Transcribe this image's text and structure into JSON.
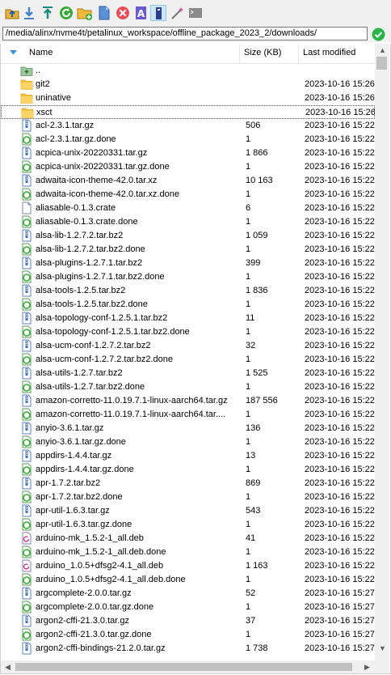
{
  "toolbar": {
    "buttons": [
      {
        "name": "parent-dir-button",
        "icon": "folder-up-icon"
      },
      {
        "name": "download-button",
        "icon": "download-arrow-icon"
      },
      {
        "name": "upload-button",
        "icon": "upload-arrow-icon"
      },
      {
        "name": "refresh-button",
        "icon": "refresh-icon"
      },
      {
        "name": "new-folder-button",
        "icon": "new-folder-icon"
      },
      {
        "name": "new-file-button",
        "icon": "new-file-icon"
      },
      {
        "name": "delete-button",
        "icon": "delete-icon"
      },
      {
        "name": "rename-button",
        "icon": "rename-icon"
      },
      {
        "name": "properties-button",
        "icon": "properties-icon"
      },
      {
        "name": "filter-button",
        "icon": "magic-wand-icon"
      },
      {
        "name": "terminal-button",
        "icon": "terminal-icon"
      }
    ]
  },
  "path": {
    "value": "/media/alinx/nvme4t/petalinux_workspace/offline_package_2023_2/downloads/"
  },
  "columns": {
    "name": "Name",
    "size": "Size (KB)",
    "modified": "Last modified"
  },
  "colors": {
    "folder": "#f5c342",
    "selection_border": "#555555",
    "ok_green": "#2db34a"
  },
  "files": [
    {
      "name": "..",
      "size": "",
      "date": "",
      "icon": "parent-folder-icon"
    },
    {
      "name": "git2",
      "size": "",
      "date": "2023-10-16 15:26",
      "icon": "folder-icon"
    },
    {
      "name": "uninative",
      "size": "",
      "date": "2023-10-16 15:26",
      "icon": "folder-icon"
    },
    {
      "name": "xsct",
      "size": "",
      "date": "2023-10-16 15:26",
      "icon": "folder-icon",
      "focused": true
    },
    {
      "name": "acl-2.3.1.tar.gz",
      "size": "506",
      "date": "2023-10-16 15:22",
      "icon": "archive-icon"
    },
    {
      "name": "acl-2.3.1.tar.gz.done",
      "size": "1",
      "date": "2023-10-16 15:22",
      "icon": "done-file-icon"
    },
    {
      "name": "acpica-unix-20220331.tar.gz",
      "size": "1 866",
      "date": "2023-10-16 15:22",
      "icon": "archive-icon"
    },
    {
      "name": "acpica-unix-20220331.tar.gz.done",
      "size": "1",
      "date": "2023-10-16 15:22",
      "icon": "done-file-icon"
    },
    {
      "name": "adwaita-icon-theme-42.0.tar.xz",
      "size": "10 163",
      "date": "2023-10-16 15:22",
      "icon": "archive-icon"
    },
    {
      "name": "adwaita-icon-theme-42.0.tar.xz.done",
      "size": "1",
      "date": "2023-10-16 15:22",
      "icon": "done-file-icon"
    },
    {
      "name": "aliasable-0.1.3.crate",
      "size": "6",
      "date": "2023-10-16 15:22",
      "icon": "file-icon"
    },
    {
      "name": "aliasable-0.1.3.crate.done",
      "size": "1",
      "date": "2023-10-16 15:22",
      "icon": "done-file-icon"
    },
    {
      "name": "alsa-lib-1.2.7.2.tar.bz2",
      "size": "1 059",
      "date": "2023-10-16 15:22",
      "icon": "archive-icon"
    },
    {
      "name": "alsa-lib-1.2.7.2.tar.bz2.done",
      "size": "1",
      "date": "2023-10-16 15:22",
      "icon": "done-file-icon"
    },
    {
      "name": "alsa-plugins-1.2.7.1.tar.bz2",
      "size": "399",
      "date": "2023-10-16 15:22",
      "icon": "archive-icon"
    },
    {
      "name": "alsa-plugins-1.2.7.1.tar.bz2.done",
      "size": "1",
      "date": "2023-10-16 15:22",
      "icon": "done-file-icon"
    },
    {
      "name": "alsa-tools-1.2.5.tar.bz2",
      "size": "1 836",
      "date": "2023-10-16 15:22",
      "icon": "archive-icon"
    },
    {
      "name": "alsa-tools-1.2.5.tar.bz2.done",
      "size": "1",
      "date": "2023-10-16 15:22",
      "icon": "done-file-icon"
    },
    {
      "name": "alsa-topology-conf-1.2.5.1.tar.bz2",
      "size": "11",
      "date": "2023-10-16 15:22",
      "icon": "archive-icon"
    },
    {
      "name": "alsa-topology-conf-1.2.5.1.tar.bz2.done",
      "size": "1",
      "date": "2023-10-16 15:22",
      "icon": "done-file-icon"
    },
    {
      "name": "alsa-ucm-conf-1.2.7.2.tar.bz2",
      "size": "32",
      "date": "2023-10-16 15:22",
      "icon": "archive-icon"
    },
    {
      "name": "alsa-ucm-conf-1.2.7.2.tar.bz2.done",
      "size": "1",
      "date": "2023-10-16 15:22",
      "icon": "done-file-icon"
    },
    {
      "name": "alsa-utils-1.2.7.tar.bz2",
      "size": "1 525",
      "date": "2023-10-16 15:22",
      "icon": "archive-icon"
    },
    {
      "name": "alsa-utils-1.2.7.tar.bz2.done",
      "size": "1",
      "date": "2023-10-16 15:22",
      "icon": "done-file-icon"
    },
    {
      "name": "amazon-corretto-11.0.19.7.1-linux-aarch64.tar.gz",
      "size": "187 556",
      "date": "2023-10-16 15:22",
      "icon": "archive-icon"
    },
    {
      "name": "amazon-corretto-11.0.19.7.1-linux-aarch64.tar....",
      "size": "1",
      "date": "2023-10-16 15:22",
      "icon": "done-file-icon"
    },
    {
      "name": "anyio-3.6.1.tar.gz",
      "size": "136",
      "date": "2023-10-16 15:22",
      "icon": "archive-icon"
    },
    {
      "name": "anyio-3.6.1.tar.gz.done",
      "size": "1",
      "date": "2023-10-16 15:22",
      "icon": "done-file-icon"
    },
    {
      "name": "appdirs-1.4.4.tar.gz",
      "size": "13",
      "date": "2023-10-16 15:22",
      "icon": "archive-icon"
    },
    {
      "name": "appdirs-1.4.4.tar.gz.done",
      "size": "1",
      "date": "2023-10-16 15:22",
      "icon": "done-file-icon"
    },
    {
      "name": "apr-1.7.2.tar.bz2",
      "size": "869",
      "date": "2023-10-16 15:22",
      "icon": "archive-icon"
    },
    {
      "name": "apr-1.7.2.tar.bz2.done",
      "size": "1",
      "date": "2023-10-16 15:22",
      "icon": "done-file-icon"
    },
    {
      "name": "apr-util-1.6.3.tar.gz",
      "size": "543",
      "date": "2023-10-16 15:22",
      "icon": "archive-icon"
    },
    {
      "name": "apr-util-1.6.3.tar.gz.done",
      "size": "1",
      "date": "2023-10-16 15:22",
      "icon": "done-file-icon"
    },
    {
      "name": "arduino-mk_1.5.2-1_all.deb",
      "size": "41",
      "date": "2023-10-16 15:22",
      "icon": "deb-package-icon"
    },
    {
      "name": "arduino-mk_1.5.2-1_all.deb.done",
      "size": "1",
      "date": "2023-10-16 15:22",
      "icon": "done-file-icon"
    },
    {
      "name": "arduino_1.0.5+dfsg2-4.1_all.deb",
      "size": "1 163",
      "date": "2023-10-16 15:22",
      "icon": "deb-package-icon"
    },
    {
      "name": "arduino_1.0.5+dfsg2-4.1_all.deb.done",
      "size": "1",
      "date": "2023-10-16 15:22",
      "icon": "done-file-icon"
    },
    {
      "name": "argcomplete-2.0.0.tar.gz",
      "size": "52",
      "date": "2023-10-16 15:27",
      "icon": "archive-icon"
    },
    {
      "name": "argcomplete-2.0.0.tar.gz.done",
      "size": "1",
      "date": "2023-10-16 15:27",
      "icon": "done-file-icon"
    },
    {
      "name": "argon2-cffi-21.3.0.tar.gz",
      "size": "37",
      "date": "2023-10-16 15:27",
      "icon": "archive-icon"
    },
    {
      "name": "argon2-cffi-21.3.0.tar.gz.done",
      "size": "1",
      "date": "2023-10-16 15:27",
      "icon": "done-file-icon"
    },
    {
      "name": "argon2-cffi-bindings-21.2.0.tar.gz",
      "size": "1 738",
      "date": "2023-10-16 15:27",
      "icon": "archive-icon"
    }
  ]
}
